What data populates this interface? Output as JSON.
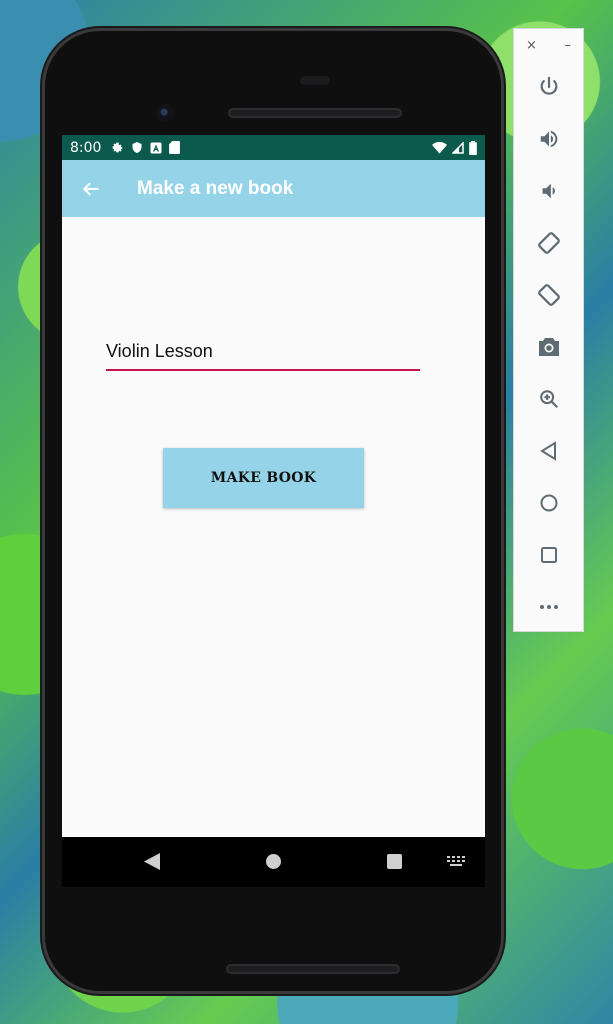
{
  "status_bar": {
    "time": "8:00"
  },
  "app_bar": {
    "title": "Make a new book"
  },
  "form": {
    "book_name_value": "Violin Lesson"
  },
  "button": {
    "label": "MAKE BOOK"
  },
  "emulator_panel": {
    "close": "×",
    "minimize": "–"
  },
  "colors": {
    "app_bar": "#95d3e8",
    "status_bar": "#0c5a4e",
    "input_underline": "#c2144d"
  },
  "icons": [
    "back-arrow-icon",
    "gear-icon",
    "shield-icon",
    "a-icon",
    "sd-card-icon",
    "wifi-icon",
    "signal-icon",
    "battery-icon",
    "power-icon",
    "volume-up-icon",
    "volume-down-icon",
    "rotate-left-icon",
    "rotate-right-icon",
    "camera-icon",
    "zoom-icon",
    "back-icon",
    "home-icon",
    "overview-icon",
    "more-icon"
  ]
}
